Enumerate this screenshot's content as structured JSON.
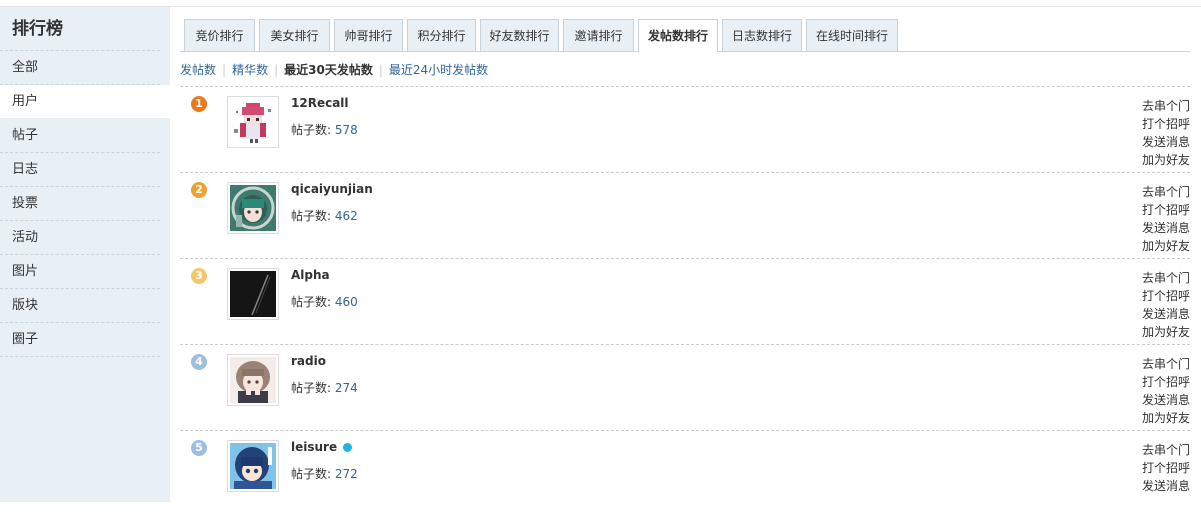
{
  "sidebar": {
    "title": "排行榜",
    "items": [
      {
        "label": "全部"
      },
      {
        "label": "用户"
      },
      {
        "label": "帖子"
      },
      {
        "label": "日志"
      },
      {
        "label": "投票"
      },
      {
        "label": "活动"
      },
      {
        "label": "图片"
      },
      {
        "label": "版块"
      },
      {
        "label": "圈子"
      }
    ],
    "active_index": 1
  },
  "tabs": {
    "items": [
      {
        "label": "竞价排行"
      },
      {
        "label": "美女排行"
      },
      {
        "label": "帅哥排行"
      },
      {
        "label": "积分排行"
      },
      {
        "label": "好友数排行"
      },
      {
        "label": "邀请排行"
      },
      {
        "label": "发帖数排行"
      },
      {
        "label": "日志数排行"
      },
      {
        "label": "在线时间排行"
      }
    ],
    "active_index": 6
  },
  "subnav": {
    "items": [
      {
        "label": "发帖数"
      },
      {
        "label": "精华数"
      },
      {
        "label": "最近30天发帖数"
      },
      {
        "label": "最近24小时发帖数"
      }
    ],
    "active_index": 2
  },
  "rankings": {
    "post_label": "帖子数:",
    "actions": [
      "去串个门",
      "打个招呼",
      "发送消息",
      "加为好友"
    ],
    "rank_colors": [
      "#ec7a1d",
      "#f0a131",
      "#f5c766",
      "#9cbfe0",
      "#9cbfe0"
    ],
    "rows": [
      {
        "rank": "1",
        "name": "12Recall",
        "posts": "578",
        "avatar_icon": "avatar-pixel-girl-icon"
      },
      {
        "rank": "2",
        "name": "qicaiyunjian",
        "posts": "462",
        "avatar_icon": "avatar-green-hair-icon"
      },
      {
        "rank": "3",
        "name": "Alpha",
        "posts": "460",
        "avatar_icon": "avatar-dark-streak-icon"
      },
      {
        "rank": "4",
        "name": "radio",
        "posts": "274",
        "avatar_icon": "avatar-brown-hair-girl-icon"
      },
      {
        "rank": "5",
        "name": "leisure",
        "posts": "272",
        "avatar_icon": "avatar-blue-hair-icon",
        "online": true
      }
    ]
  }
}
